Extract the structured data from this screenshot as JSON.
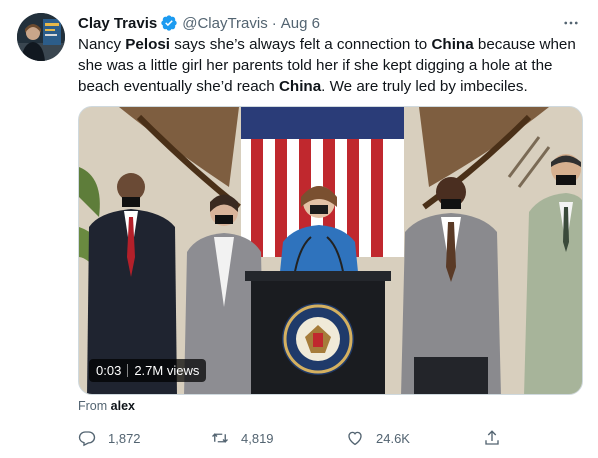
{
  "tweet": {
    "author": {
      "display_name": "Clay Travis",
      "handle": "@ClayTravis",
      "separator": "·",
      "date": "Aug 6",
      "verified": true
    },
    "text": {
      "p1": "Nancy ",
      "b1": "Pelosi",
      "p2": " says she’s always felt a connection to ",
      "b2": "China",
      "p3": " because when she was a little girl her parents told her if she kept digging a hole at the beach eventually she’d reach ",
      "b3": "China",
      "p4": ". We are truly led by imbeciles."
    },
    "media": {
      "type": "video",
      "timestamp": "0:03",
      "views": "2.7M views"
    },
    "source": {
      "prefix": "From",
      "name": "alex"
    },
    "actions": {
      "replies": "1,872",
      "retweets": "4,819",
      "likes": "24.6K"
    }
  },
  "colors": {
    "verified_badge": "#1d9bf0",
    "secondary_text": "#536471",
    "primary_text": "#0f1419"
  },
  "icons": [
    "more-icon",
    "verified-badge-icon",
    "reply-icon",
    "retweet-icon",
    "like-icon",
    "share-icon"
  ]
}
